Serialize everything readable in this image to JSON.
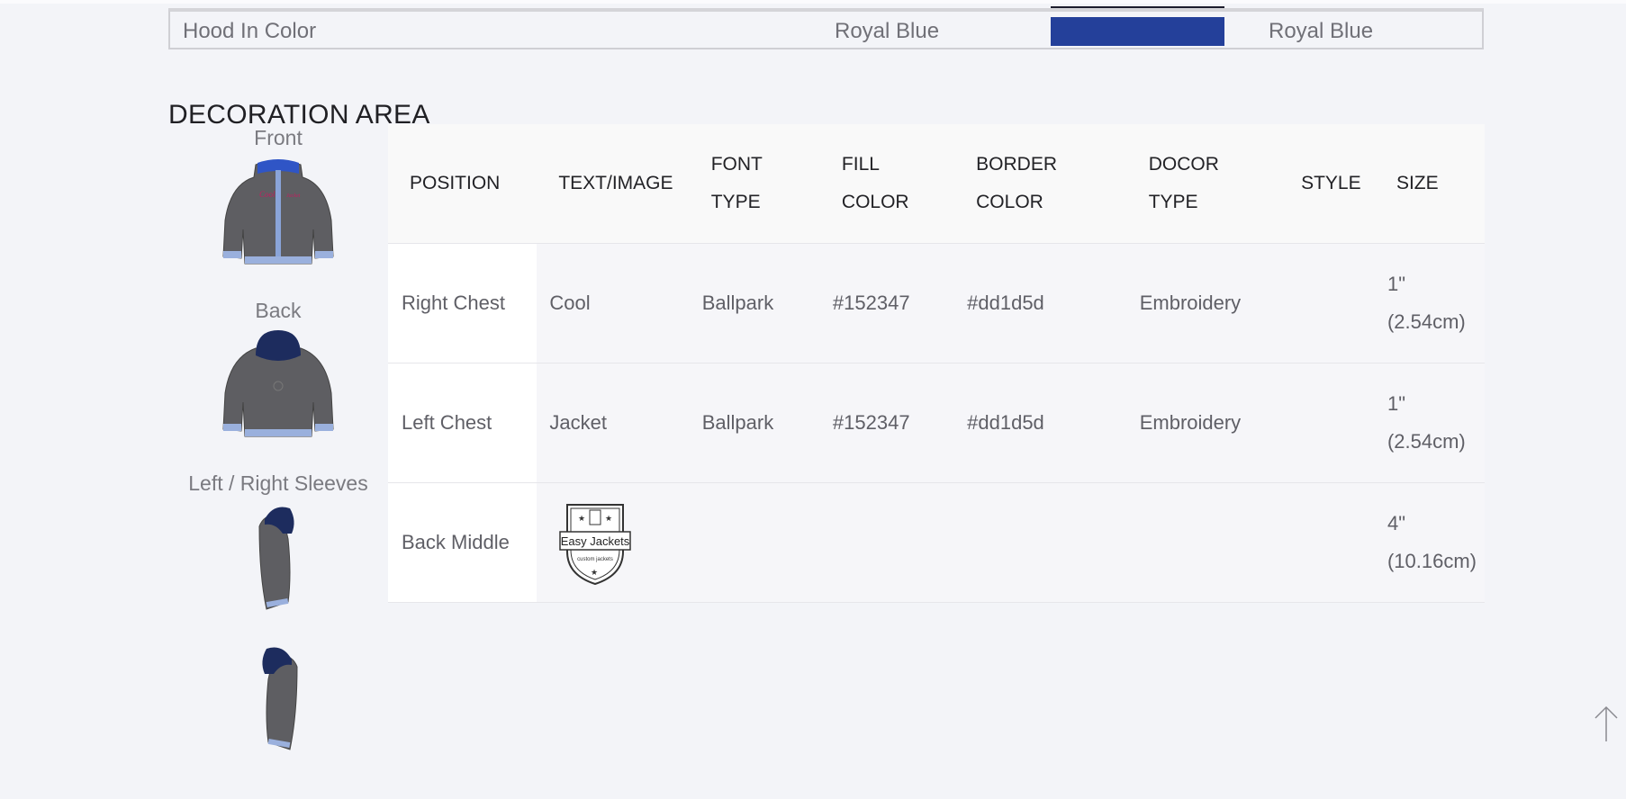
{
  "colors_table": {
    "row_label": "Hood In Color",
    "value": "Royal Blue",
    "swatch_color": "#24409a",
    "value_repeat": "Royal Blue"
  },
  "decoration": {
    "title": "DECORATION AREA",
    "views": [
      {
        "label": "Front",
        "image": "jacket-front"
      },
      {
        "label": "Back",
        "image": "jacket-back"
      },
      {
        "label": "Left / Right Sleeves",
        "image": "jacket-sleeves"
      }
    ],
    "headers": [
      "POSITION",
      "TEXT/IMAGE",
      "FONT TYPE",
      "FILL COLOR",
      "BORDER COLOR",
      "DOCOR TYPE",
      "STYLE",
      "SIZE"
    ],
    "header_lines": [
      [
        "POSITION"
      ],
      [
        "TEXT/IMAGE"
      ],
      [
        "FONT",
        "TYPE"
      ],
      [
        "FILL",
        "COLOR"
      ],
      [
        "BORDER",
        "COLOR"
      ],
      [
        "DOCOR",
        "TYPE"
      ],
      [
        "STYLE"
      ],
      [
        "SIZE"
      ]
    ],
    "rows": [
      {
        "position": "Right Chest",
        "text_image": "Cool",
        "font_type": "Ballpark",
        "fill_color": "#152347",
        "border_color": "#dd1d5d",
        "docor_type": "Embroidery",
        "style": "",
        "size_line1": "1\"",
        "size_line2": "(2.54cm)"
      },
      {
        "position": "Left Chest",
        "text_image": "Jacket",
        "font_type": "Ballpark",
        "fill_color": "#152347",
        "border_color": "#dd1d5d",
        "docor_type": "Embroidery",
        "style": "",
        "size_line1": "1\"",
        "size_line2": "(2.54cm)"
      },
      {
        "position": "Back Middle",
        "text_image": "",
        "logo_text": "Easy Jackets",
        "logo_subtext": "custom jackets",
        "font_type": "",
        "fill_color": "",
        "border_color": "",
        "docor_type": "",
        "style": "",
        "size_line1": "4\"",
        "size_line2": "(10.16cm)"
      }
    ]
  },
  "scroll_top": {
    "icon": "arrow-up-icon"
  }
}
